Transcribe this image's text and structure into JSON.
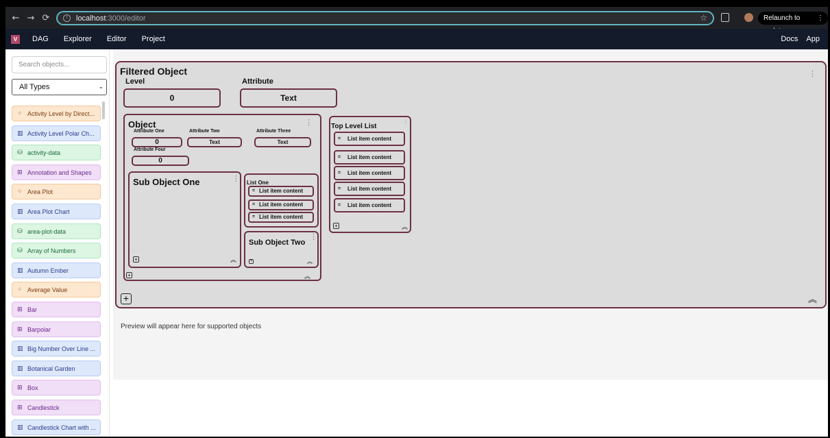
{
  "browser": {
    "back": "←",
    "forward": "→",
    "reload": "⟳",
    "url_host": "localhost",
    "url_path": ":3000/editor",
    "relaunch_label": "Relaunch to update"
  },
  "appnav": {
    "logo": "V",
    "items": [
      "DAG",
      "Explorer",
      "Editor",
      "Project"
    ],
    "right_items": [
      "Docs",
      "App"
    ]
  },
  "sidebar": {
    "search_placeholder": "Search objects...",
    "type_filter": "All Types",
    "items": [
      {
        "label": "Activity Level by Direct...",
        "kind": "orange",
        "icon": "scatter-icon"
      },
      {
        "label": "Activity Level Polar Ch...",
        "kind": "blue",
        "icon": "chart-icon"
      },
      {
        "label": "activity-data",
        "kind": "green",
        "icon": "database-icon"
      },
      {
        "label": "Annotation and Shapes",
        "kind": "purple",
        "icon": "grid-icon"
      },
      {
        "label": "Area Plot",
        "kind": "orange",
        "icon": "scatter-icon"
      },
      {
        "label": "Area Plot Chart",
        "kind": "blue",
        "icon": "chart-icon"
      },
      {
        "label": "area-plot-data",
        "kind": "green",
        "icon": "database-icon"
      },
      {
        "label": "Array of Numbers",
        "kind": "green",
        "icon": "database-icon"
      },
      {
        "label": "Autumn Ember",
        "kind": "blue",
        "icon": "chart-icon"
      },
      {
        "label": "Average Value",
        "kind": "orange",
        "icon": "scatter-icon"
      },
      {
        "label": "Bar",
        "kind": "purple",
        "icon": "grid-icon"
      },
      {
        "label": "Barpolar",
        "kind": "purple",
        "icon": "grid-icon"
      },
      {
        "label": "Big Number Over Line ...",
        "kind": "blue",
        "icon": "chart-icon"
      },
      {
        "label": "Botanical Garden",
        "kind": "blue",
        "icon": "chart-icon"
      },
      {
        "label": "Box",
        "kind": "purple",
        "icon": "grid-icon"
      },
      {
        "label": "Candlestick",
        "kind": "purple",
        "icon": "grid-icon"
      },
      {
        "label": "Candlestick Chart with ...",
        "kind": "blue",
        "icon": "chart-icon"
      }
    ]
  },
  "editor": {
    "title": "Filtered Object",
    "level_label": "Level",
    "level_value": "0",
    "attribute_label": "Attribute",
    "attribute_value": "Text",
    "object": {
      "title": "Object",
      "attr1_label": "Attribute One",
      "attr1_value": "0",
      "attr2_label": "Attribute Two",
      "attr2_value": "Text",
      "attr3_label": "Attribute Three",
      "attr3_value": "Text",
      "attr4_label": "Attribute Four",
      "attr4_value": "0",
      "sub_one_title": "Sub Object One",
      "list_one_title": "List One",
      "list_one_items": [
        "List item content",
        "List item content",
        "List item content"
      ],
      "sub_two_title": "Sub Object Two"
    },
    "top_list": {
      "title": "Top Level List",
      "items": [
        "List item content",
        "List item content",
        "List item content",
        "List item content",
        "List item content"
      ]
    },
    "preview_text": "Preview will appear here for supported objects"
  }
}
